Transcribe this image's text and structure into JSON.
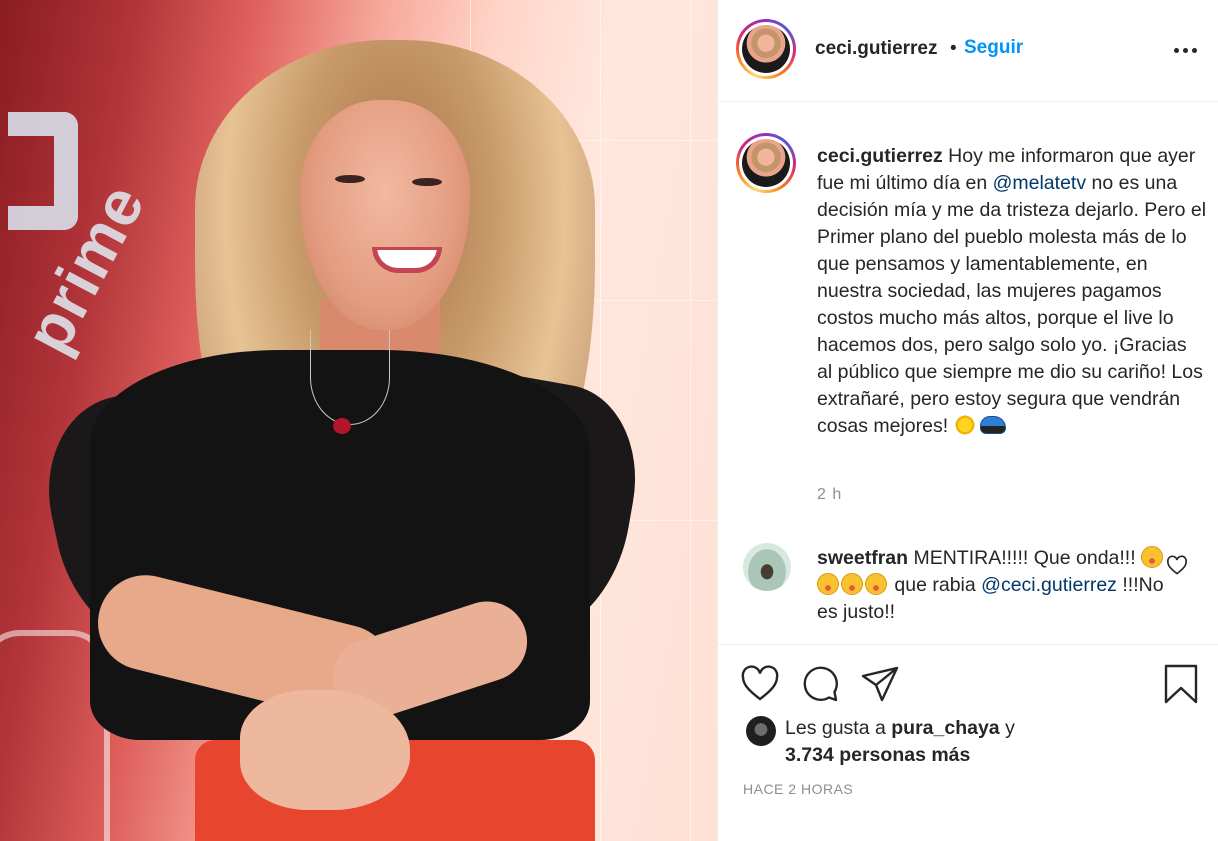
{
  "post": {
    "author": "ceci.gutierrez",
    "separator": "•",
    "follow_label": "Seguir",
    "caption_user": "ceci.gutierrez",
    "caption_part1": "Hoy me informaron que ayer fue mi último día en",
    "caption_mention": "@melatetv",
    "caption_part2": "no es una decisión mía y me da tristeza dejarlo. Pero el Primer plano del pueblo molesta más de lo que pensamos y lamentablemente, en nuestra sociedad, las mujeres pagamos costos mucho más altos, porque el live lo hacemos dos, pero salgo solo yo. ¡Gracias al público que siempre me dio su cariño! Los extrañaré, pero estoy segura que vendrán cosas mejores!",
    "caption_time": "2 h",
    "photo_text": "prime"
  },
  "comment": {
    "user": "sweetfran",
    "text_part1": "MENTIRA!!!!! Que onda!!!",
    "text_part2": "que rabia",
    "mention": "@ceci.gutierrez",
    "text_part3": "!!!No es justo!!"
  },
  "likes": {
    "prefix": "Les gusta a",
    "user": "pura_chaya",
    "conjunction": "y",
    "count_text": "3.734 personas más"
  },
  "post_date": "HACE 2 HORAS",
  "icons": {
    "more": "more-options-icon",
    "like": "heart-icon",
    "comment": "comment-bubble-icon",
    "share": "paper-plane-icon",
    "save": "bookmark-icon"
  },
  "colors": {
    "accent": "#0095f6",
    "mention": "#00376b",
    "muted": "#8e8e8e",
    "text": "#262626"
  }
}
